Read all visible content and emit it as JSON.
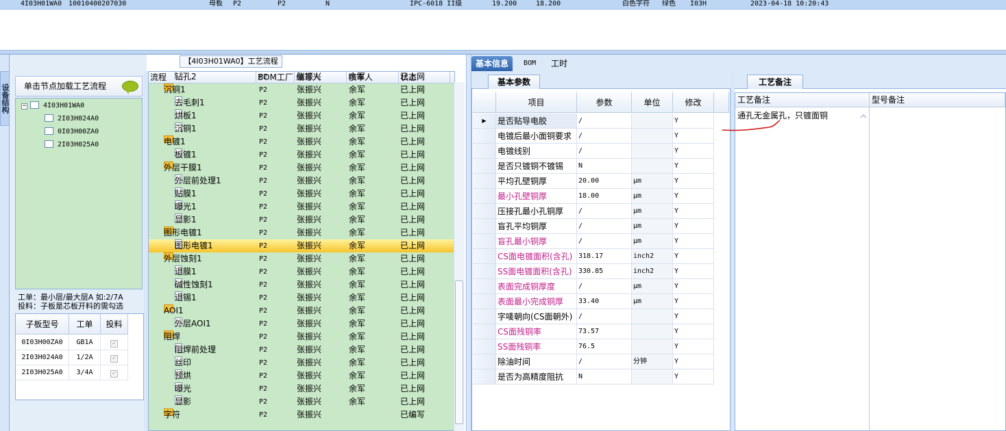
{
  "top_row": [
    "4I03H01WA0",
    "10010400207030",
    "母板",
    "P2",
    "P2",
    "N",
    "IPC-6018 II级",
    "19.200",
    "18.200",
    "白色字符",
    "绿色",
    "I03H",
    "2023-04-18 10:20:43"
  ],
  "left_tab": "设备结构",
  "load_button": "单击节点加载工艺流程",
  "left_tree": {
    "root": "4I03H01WA0",
    "children": [
      "2I03H024A0",
      "0I03H00ZA0",
      "2I03H025A0"
    ]
  },
  "hint": [
    "工单：最小层/最大层A 如:2/7A",
    "投料：子板是芯板开料的需勾选"
  ],
  "sub_grid": {
    "headers": [
      "子板型号",
      "工单",
      "投料"
    ],
    "rows": [
      [
        "0I03H00ZA0",
        "GB1A"
      ],
      [
        "2I03H024A0",
        "1/2A"
      ],
      [
        "2I03H025A0",
        "3/4A"
      ]
    ]
  },
  "process_title": "【4I03H01WA0】工艺流程",
  "process_headers": [
    "流程",
    "BOM工厂",
    "编写人",
    "核审人",
    "状态"
  ],
  "process_rows": [
    {
      "name": "钻孔2",
      "group": false,
      "bom": "P2",
      "writer": "张振兴",
      "reviewer": "余军",
      "status": "已上网"
    },
    {
      "name": "沉铜1",
      "group": true,
      "bom": "P2",
      "writer": "张振兴",
      "reviewer": "余军",
      "status": "已上网"
    },
    {
      "name": "去毛刺1",
      "group": false,
      "bom": "P2",
      "writer": "张振兴",
      "reviewer": "余军",
      "status": "已上网"
    },
    {
      "name": "烘板1",
      "group": false,
      "bom": "P2",
      "writer": "张振兴",
      "reviewer": "余军",
      "status": "已上网"
    },
    {
      "name": "沉铜1",
      "group": false,
      "bom": "P2",
      "writer": "张振兴",
      "reviewer": "余军",
      "status": "已上网"
    },
    {
      "name": "电镀1",
      "group": true,
      "bom": "P2",
      "writer": "张振兴",
      "reviewer": "余军",
      "status": "已上网"
    },
    {
      "name": "板镀1",
      "group": false,
      "bom": "P2",
      "writer": "张振兴",
      "reviewer": "余军",
      "status": "已上网"
    },
    {
      "name": "外层干膜1",
      "group": true,
      "bom": "P2",
      "writer": "张振兴",
      "reviewer": "余军",
      "status": "已上网"
    },
    {
      "name": "外层前处理1",
      "group": false,
      "bom": "P2",
      "writer": "张振兴",
      "reviewer": "余军",
      "status": "已上网"
    },
    {
      "name": "贴膜1",
      "group": false,
      "bom": "P2",
      "writer": "张振兴",
      "reviewer": "余军",
      "status": "已上网"
    },
    {
      "name": "曝光1",
      "group": false,
      "bom": "P2",
      "writer": "张振兴",
      "reviewer": "余军",
      "status": "已上网"
    },
    {
      "name": "显影1",
      "group": false,
      "bom": "P2",
      "writer": "张振兴",
      "reviewer": "余军",
      "status": "已上网"
    },
    {
      "name": "图形电镀1",
      "group": true,
      "bom": "P2",
      "writer": "张振兴",
      "reviewer": "余军",
      "status": "已上网"
    },
    {
      "name": "图形电镀1",
      "group": false,
      "selected": true,
      "bom": "P2",
      "writer": "张振兴",
      "reviewer": "余军",
      "status": "已上网"
    },
    {
      "name": "外层蚀刻1",
      "group": true,
      "bom": "P2",
      "writer": "张振兴",
      "reviewer": "余军",
      "status": "已上网"
    },
    {
      "name": "退膜1",
      "group": false,
      "bom": "P2",
      "writer": "张振兴",
      "reviewer": "余军",
      "status": "已上网"
    },
    {
      "name": "碱性蚀刻1",
      "group": false,
      "bom": "P2",
      "writer": "张振兴",
      "reviewer": "余军",
      "status": "已上网"
    },
    {
      "name": "退锡1",
      "group": false,
      "bom": "P2",
      "writer": "张振兴",
      "reviewer": "余军",
      "status": "已上网"
    },
    {
      "name": "AOI1",
      "group": true,
      "bom": "P2",
      "writer": "张振兴",
      "reviewer": "余军",
      "status": "已上网"
    },
    {
      "name": "外层AOI1",
      "group": false,
      "bom": "P2",
      "writer": "张振兴",
      "reviewer": "余军",
      "status": "已上网"
    },
    {
      "name": "阻焊",
      "group": true,
      "bom": "P2",
      "writer": "张振兴",
      "reviewer": "余军",
      "status": "已上网"
    },
    {
      "name": "阻焊前处理",
      "group": false,
      "bom": "P2",
      "writer": "张振兴",
      "reviewer": "余军",
      "status": "已上网"
    },
    {
      "name": "丝印",
      "group": false,
      "bom": "P2",
      "writer": "张振兴",
      "reviewer": "余军",
      "status": "已上网"
    },
    {
      "name": "预烘",
      "group": false,
      "bom": "P2",
      "writer": "张振兴",
      "reviewer": "余军",
      "status": "已上网"
    },
    {
      "name": "曝光",
      "group": false,
      "bom": "P2",
      "writer": "张振兴",
      "reviewer": "余军",
      "status": "已上网"
    },
    {
      "name": "显影",
      "group": false,
      "bom": "P2",
      "writer": "张振兴",
      "reviewer": "余军",
      "status": "已上网"
    },
    {
      "name": "字符",
      "group": true,
      "bom": "P2",
      "writer": "张振兴",
      "reviewer": "",
      "status": "已编写"
    }
  ],
  "right_tabs": [
    "基本信息",
    "BOM",
    "工时"
  ],
  "basic_tab": "基本参数",
  "param_headers": [
    "项目",
    "参数",
    "单位",
    "修改"
  ],
  "params": [
    {
      "item": "是否贴导电胶",
      "value": "/",
      "unit": "",
      "mod": "Y",
      "pink": false
    },
    {
      "item": "电镀后最小面铜要求",
      "value": "/",
      "unit": "",
      "mod": "Y",
      "pink": false
    },
    {
      "item": "电镀线别",
      "value": "/",
      "unit": "",
      "mod": "Y",
      "pink": false
    },
    {
      "item": "是否只镀铜不镀锡",
      "value": "N",
      "unit": "",
      "mod": "Y",
      "pink": false
    },
    {
      "item": "平均孔壁铜厚",
      "value": "20.00",
      "unit": "μm",
      "mod": "Y",
      "pink": false
    },
    {
      "item": "最小孔壁铜厚",
      "value": "18.00",
      "unit": "μm",
      "mod": "Y",
      "pink": true
    },
    {
      "item": "压接孔最小孔铜厚",
      "value": "/",
      "unit": "μm",
      "mod": "Y",
      "pink": false
    },
    {
      "item": "盲孔平均铜厚",
      "value": "/",
      "unit": "μm",
      "mod": "Y",
      "pink": false
    },
    {
      "item": "盲孔最小铜厚",
      "value": "/",
      "unit": "μm",
      "mod": "Y",
      "pink": true
    },
    {
      "item": "CS面电镀面积(含孔)",
      "value": "318.17",
      "unit": "inch2",
      "mod": "Y",
      "pink": true
    },
    {
      "item": "SS面电镀面积(含孔)",
      "value": "330.85",
      "unit": "inch2",
      "mod": "Y",
      "pink": true
    },
    {
      "item": "表面完成铜厚度",
      "value": "/",
      "unit": "μm",
      "mod": "Y",
      "pink": true
    },
    {
      "item": "表面最小完成铜厚",
      "value": "33.40",
      "unit": "μm",
      "mod": "Y",
      "pink": true
    },
    {
      "item": "字唛朝向(CS面朝外)",
      "value": "/",
      "unit": "",
      "mod": "Y",
      "pink": false
    },
    {
      "item": "CS面残铜率",
      "value": "73.57",
      "unit": "",
      "mod": "Y",
      "pink": true
    },
    {
      "item": "SS面残铜率",
      "value": "76.5",
      "unit": "",
      "mod": "Y",
      "pink": true
    },
    {
      "item": "除油时间",
      "value": "/",
      "unit": "分钟",
      "mod": "Y",
      "pink": false
    },
    {
      "item": "是否为高精度阻抗",
      "value": "N",
      "unit": "",
      "mod": "Y",
      "pink": false
    }
  ],
  "notes_tab": "工艺备注",
  "notes_headers": [
    "工艺备注",
    "型号备注"
  ],
  "note_text": "通孔无金属孔，只镀面铜",
  "colors": {
    "pink_text": "#c0208a",
    "annotation": "#d01818"
  }
}
